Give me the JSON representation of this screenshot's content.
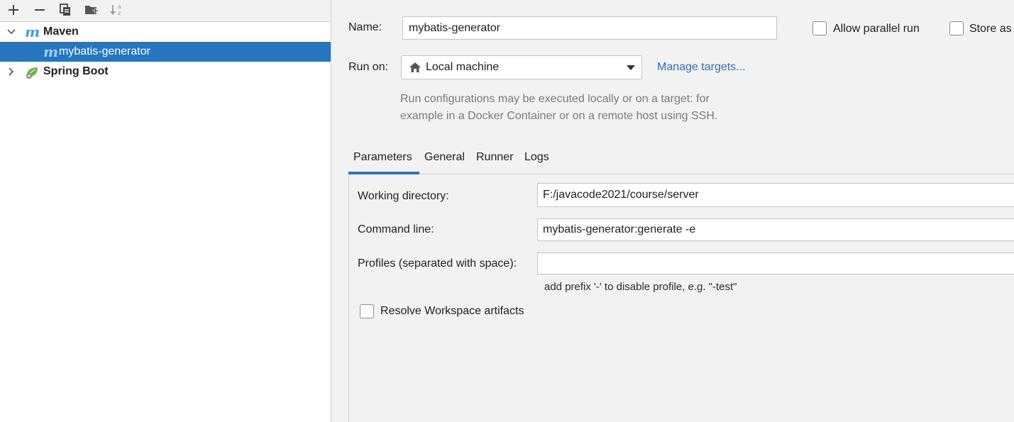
{
  "toolbar": {
    "icons": [
      "add-icon",
      "remove-icon",
      "copy-icon",
      "new-folder-icon",
      "sort-alphabetically-icon"
    ]
  },
  "tree": {
    "items": [
      {
        "label": "Maven",
        "expanded": true,
        "bold": true,
        "icon": "maven-icon"
      },
      {
        "label": "mybatis-generator",
        "selected": true,
        "icon": "maven-icon"
      },
      {
        "label": "Spring Boot",
        "expanded": false,
        "bold": true,
        "icon": "spring-boot-icon"
      }
    ]
  },
  "form": {
    "name_label": "Name:",
    "name_value": "mybatis-generator",
    "allow_parallel_label": "Allow parallel run",
    "store_as_label": "Store as",
    "run_on_label": "Run on:",
    "run_on_value": "Local machine",
    "manage_targets_label": "Manage targets...",
    "hint_line1": "Run configurations may be executed locally or on a target: for",
    "hint_line2": "example in a Docker Container or on a remote host using SSH."
  },
  "tabs": [
    {
      "label": "Parameters",
      "active": true
    },
    {
      "label": "General",
      "active": false
    },
    {
      "label": "Runner",
      "active": false
    },
    {
      "label": "Logs",
      "active": false
    }
  ],
  "parameters": {
    "working_dir_label": "Working directory:",
    "working_dir_value": "F:/javacode2021/course/server",
    "command_line_label": "Command line:",
    "command_line_value": "mybatis-generator:generate -e",
    "profiles_label": "Profiles (separated with space):",
    "profiles_value": "",
    "profiles_hint": "add prefix '-' to disable profile, e.g. \"-test\"",
    "resolve_workspace_label": "Resolve Workspace artifacts"
  },
  "colors": {
    "selection": "#2675bf",
    "link": "#2f6fb4",
    "maven": "#3f9fd6",
    "spring": "#6cb33f",
    "tab_underline": "#3574c4"
  }
}
